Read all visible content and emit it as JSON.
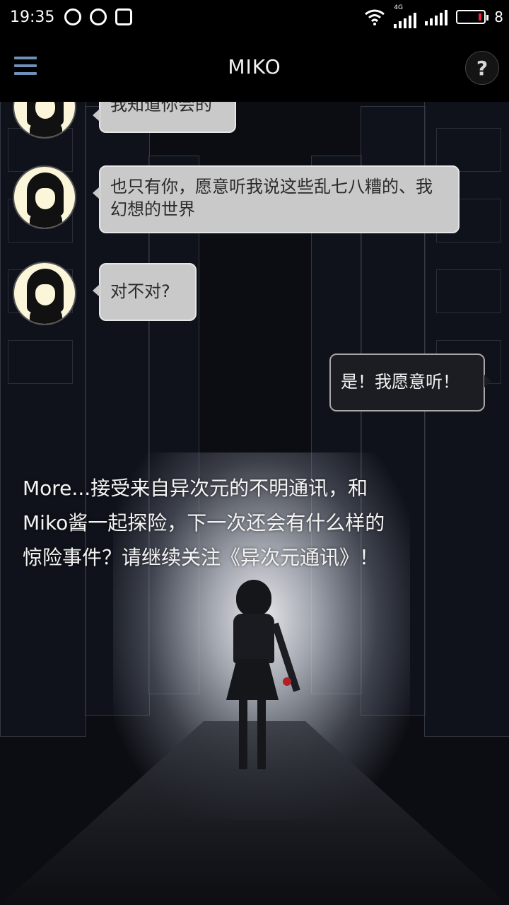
{
  "status_bar": {
    "time": "19:35",
    "network_label": "4G",
    "battery_level": "8"
  },
  "app_bar": {
    "title": "MIKO",
    "help_label": "?"
  },
  "chat": {
    "messages": [
      {
        "sender": "miko",
        "text": "我知道你会的"
      },
      {
        "sender": "miko",
        "text": "也只有你，愿意听我说这些乱七八糟的、我幻想的世界"
      },
      {
        "sender": "miko",
        "text": "对不对?"
      },
      {
        "sender": "me",
        "text": "是！我愿意听！"
      }
    ],
    "more_text": "More...接受来自异次元的不明通讯，和Miko酱一起探险，下一次还会有什么样的惊险事件？请继续关注《异次元通讯》！"
  },
  "colors": {
    "bar_background": "#000000",
    "menu_icon": "#6f90b8",
    "bubble_incoming": "#c9c9c9",
    "bubble_outgoing": "#1b1d22",
    "battery_low": "#e22233"
  }
}
